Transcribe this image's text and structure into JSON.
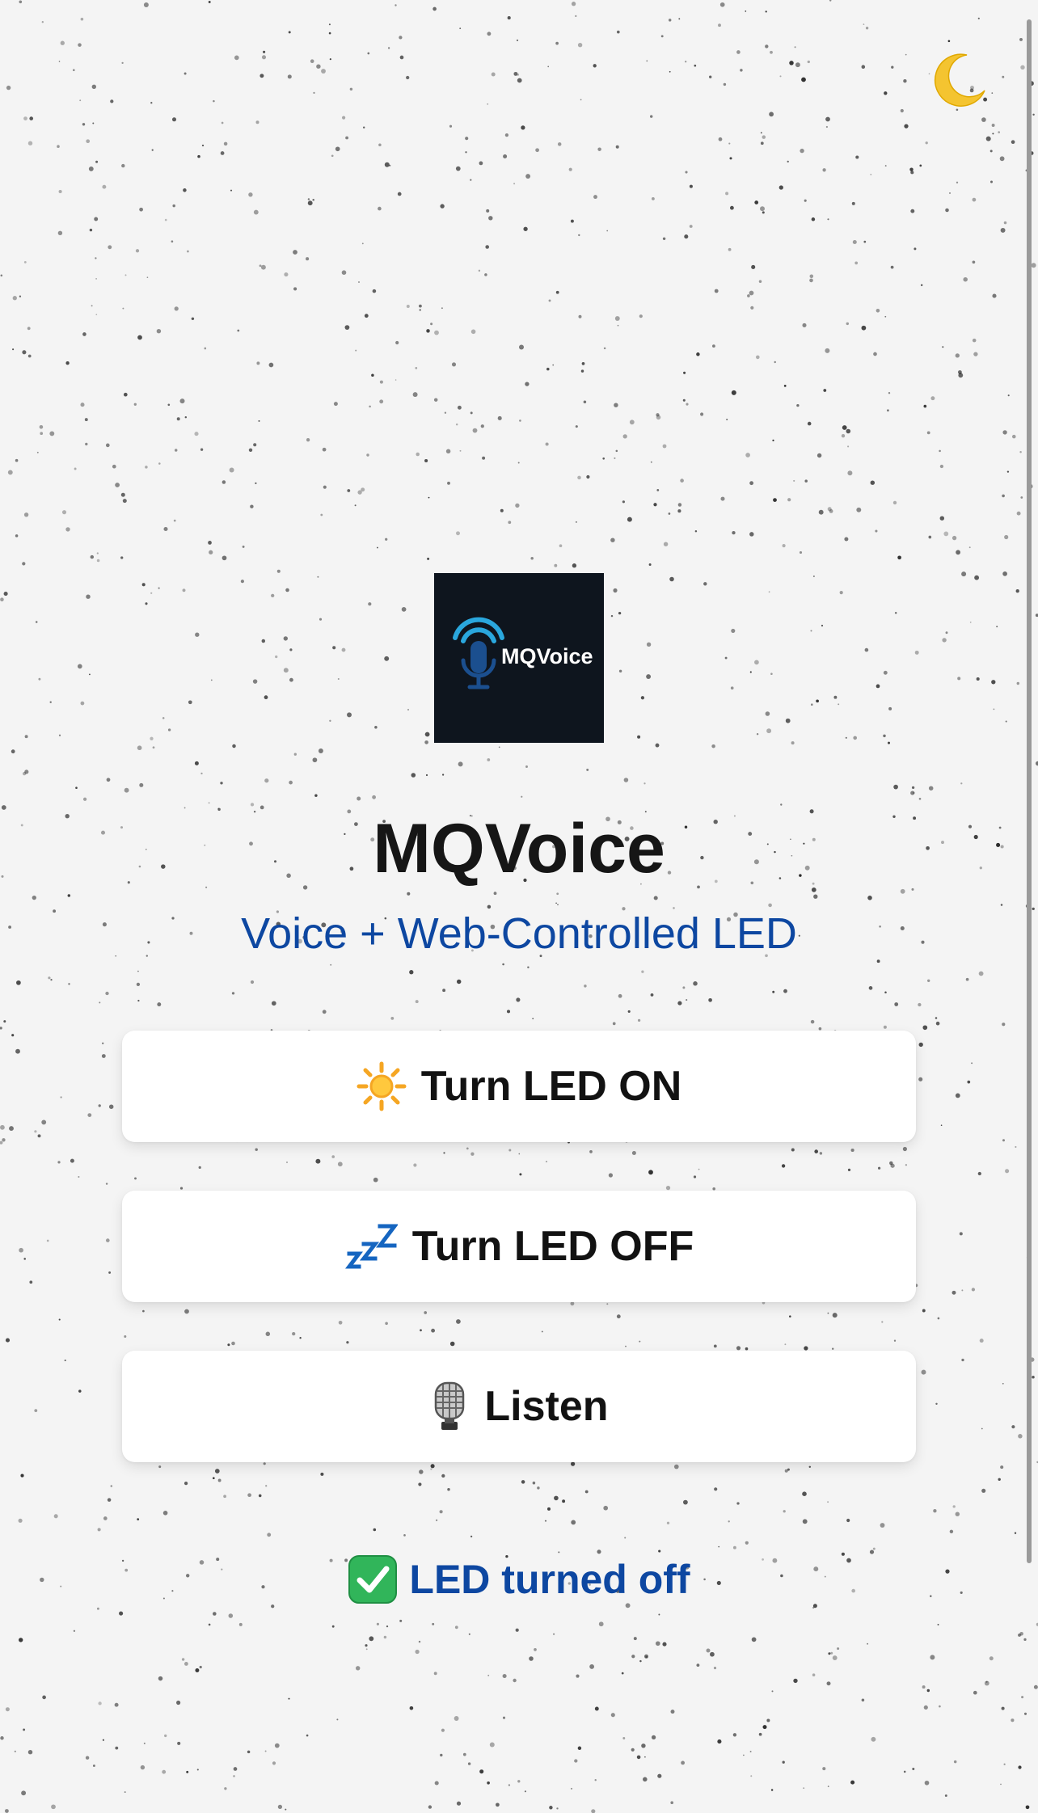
{
  "theme_toggle": {
    "icon": "crescent-moon-icon",
    "color": "#f4c430"
  },
  "logo": {
    "text": "MQVoice",
    "icon": "microphone-icon",
    "background": "#0e151e",
    "accent": "#2aa7dd"
  },
  "header": {
    "title": "MQVoice",
    "subtitle": "Voice + Web-Controlled LED",
    "subtitle_color": "#0d47a1"
  },
  "buttons": [
    {
      "label": "Turn LED ON",
      "icon": "sun-icon"
    },
    {
      "label": "Turn LED OFF",
      "icon": "zzz-icon"
    },
    {
      "label": "Listen",
      "icon": "studio-microphone-icon"
    }
  ],
  "status": {
    "icon": "check-mark-icon",
    "text": "LED turned off",
    "color": "#0d47a1"
  }
}
